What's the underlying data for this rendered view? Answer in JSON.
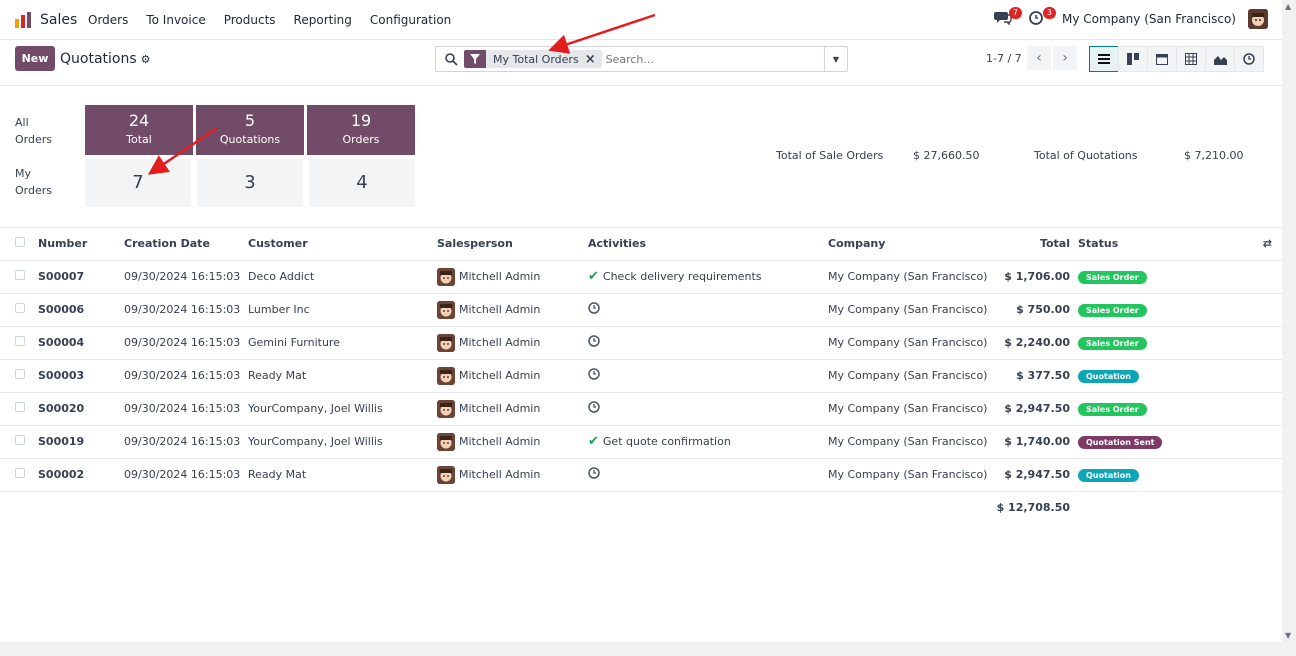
{
  "app": {
    "name": "Sales",
    "menu": [
      "Orders",
      "To Invoice",
      "Products",
      "Reporting",
      "Configuration"
    ],
    "chat_count": "7",
    "activity_count": "3",
    "company": "My Company (San Francisco)"
  },
  "control": {
    "new_label": "New",
    "breadcrumb": "Quotations",
    "facet_label": "My Total Orders",
    "search_placeholder": "Search...",
    "pager": "1-7 / 7"
  },
  "dashboard": {
    "row1_label_a": "All",
    "row1_label_b": "Orders",
    "row2_label_a": "My",
    "row2_label_b": "Orders",
    "tiles": [
      {
        "num": "24",
        "label": "Total",
        "mine": "7"
      },
      {
        "num": "5",
        "label": "Quotations",
        "mine": "3"
      },
      {
        "num": "19",
        "label": "Orders",
        "mine": "4"
      }
    ],
    "total_sale_label": "Total of Sale Orders",
    "total_sale_value": "$ 27,660.50",
    "total_quot_label": "Total of Quotations",
    "total_quot_value": "$ 7,210.00"
  },
  "table": {
    "headers": {
      "number": "Number",
      "date": "Creation Date",
      "customer": "Customer",
      "salesperson": "Salesperson",
      "activities": "Activities",
      "company": "Company",
      "total": "Total",
      "status": "Status"
    },
    "rows": [
      {
        "number": "S00007",
        "date": "09/30/2024 16:15:03",
        "customer": "Deco Addict",
        "salesperson": "Mitchell Admin",
        "activity": "Check delivery requirements",
        "company": "My Company (San Francisco)",
        "total": "$ 1,706.00",
        "status": "Sales Order"
      },
      {
        "number": "S00006",
        "date": "09/30/2024 16:15:03",
        "customer": "Lumber Inc",
        "salesperson": "Mitchell Admin",
        "activity": "",
        "company": "My Company (San Francisco)",
        "total": "$ 750.00",
        "status": "Sales Order"
      },
      {
        "number": "S00004",
        "date": "09/30/2024 16:15:03",
        "customer": "Gemini Furniture",
        "salesperson": "Mitchell Admin",
        "activity": "",
        "company": "My Company (San Francisco)",
        "total": "$ 2,240.00",
        "status": "Sales Order"
      },
      {
        "number": "S00003",
        "date": "09/30/2024 16:15:03",
        "customer": "Ready Mat",
        "salesperson": "Mitchell Admin",
        "activity": "",
        "company": "My Company (San Francisco)",
        "total": "$ 377.50",
        "status": "Quotation"
      },
      {
        "number": "S00020",
        "date": "09/30/2024 16:15:03",
        "customer": "YourCompany, Joel Willis",
        "salesperson": "Mitchell Admin",
        "activity": "",
        "company": "My Company (San Francisco)",
        "total": "$ 2,947.50",
        "status": "Sales Order"
      },
      {
        "number": "S00019",
        "date": "09/30/2024 16:15:03",
        "customer": "YourCompany, Joel Willis",
        "salesperson": "Mitchell Admin",
        "activity": "Get quote confirmation",
        "company": "My Company (San Francisco)",
        "total": "$ 1,740.00",
        "status": "Quotation Sent"
      },
      {
        "number": "S00002",
        "date": "09/30/2024 16:15:03",
        "customer": "Ready Mat",
        "salesperson": "Mitchell Admin",
        "activity": "",
        "company": "My Company (San Francisco)",
        "total": "$ 2,947.50",
        "status": "Quotation"
      }
    ],
    "grand_total": "$ 12,708.50"
  },
  "colors": {
    "brand": "#714b67",
    "sales_order": "#22c55e",
    "quotation": "#0ea5b7",
    "quotation_sent": "#7c3a64",
    "annotation_arrow": "#e11d1d"
  }
}
